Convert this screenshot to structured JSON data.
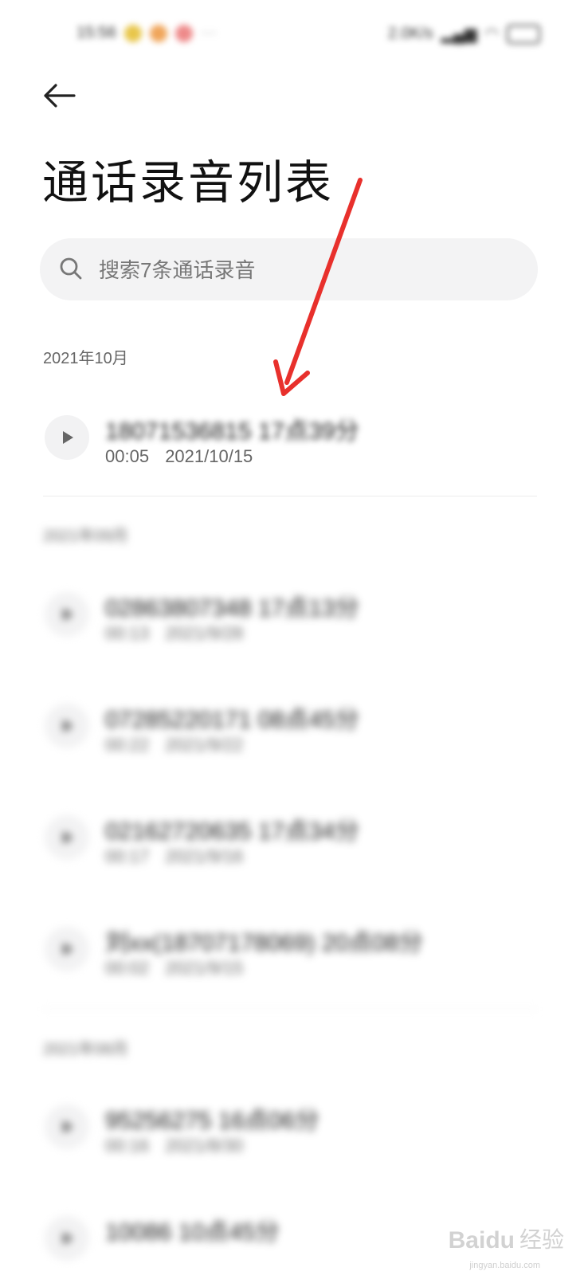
{
  "status_bar": {
    "time": "15:56",
    "right_text": "2.0K/s"
  },
  "header": {
    "back_icon": "arrow-left-icon",
    "title": "通话录音列表"
  },
  "search": {
    "placeholder": "搜索7条通话录音"
  },
  "sections": [
    {
      "header": "2021年10月",
      "items": [
        {
          "name": "18071536815 17点39分",
          "duration": "00:05",
          "date": "2021/10/15"
        }
      ]
    },
    {
      "header": "2021年09月",
      "items": [
        {
          "name": "02863807348 17点13分",
          "duration": "00:13",
          "date": "2021/9/28"
        },
        {
          "name": "07285220171 08点45分",
          "duration": "00:22",
          "date": "2021/9/22"
        },
        {
          "name": "02162720635 17点34分",
          "duration": "00:17",
          "date": "2021/9/16"
        },
        {
          "name": "刘xx(18707178069) 20点08分",
          "duration": "00:02",
          "date": "2021/9/15"
        }
      ]
    },
    {
      "header": "2021年08月",
      "items": [
        {
          "name": "95256275 16点06分",
          "duration": "00:16",
          "date": "2021/8/30"
        },
        {
          "name": "10086 10点45分",
          "duration": "",
          "date": ""
        }
      ]
    }
  ],
  "watermark": {
    "logo": "Baidu",
    "cn": "经验",
    "url": "jingyan.baidu.com"
  },
  "colors": {
    "annotation_arrow": "#e8302c",
    "search_bg": "#f3f3f4"
  }
}
